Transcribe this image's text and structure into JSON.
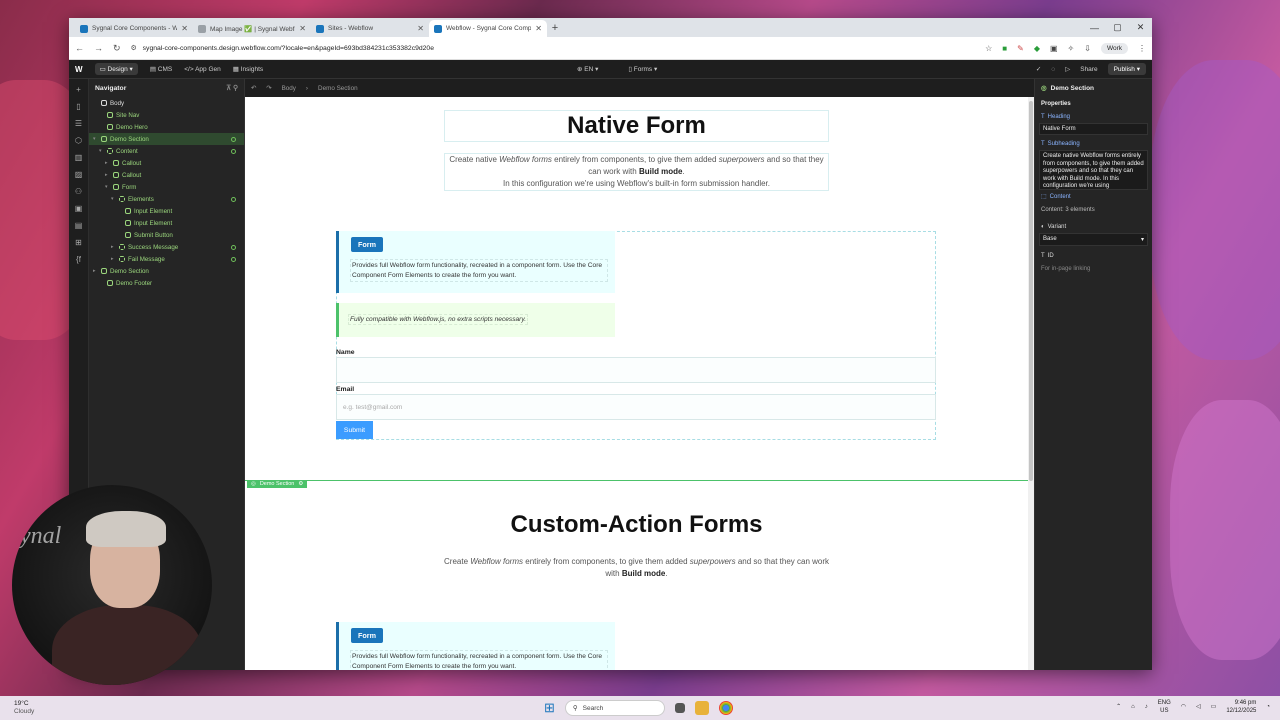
{
  "browser": {
    "tabs": [
      {
        "label": "Sygnal Core Components - We",
        "color": "#1a75bb"
      },
      {
        "label": "Map Image ✅ | Sygnal Webflo",
        "color": "#9aa0a6"
      },
      {
        "label": "Sites - Webflow",
        "color": "#1a75bb"
      },
      {
        "label": "Webflow - Sygnal Core Comp",
        "color": "#1a75bb"
      }
    ],
    "url": "sygnal-core-components.design.webflow.com/?locale=en&pageId=693bd384231c353382c9d20e",
    "profile_label": "Work"
  },
  "webflow_top": {
    "mode_label": "Design",
    "menu": [
      "CMS",
      "App Gen",
      "Insights"
    ],
    "locale": "EN",
    "page_label": "Forms",
    "share_label": "Share",
    "publish_label": "Publish"
  },
  "navigator": {
    "title": "Navigator",
    "items": [
      {
        "label": "Body",
        "indent": 0
      },
      {
        "label": "Site Nav",
        "indent": 1
      },
      {
        "label": "Demo Hero",
        "indent": 1
      },
      {
        "label": "Demo Section",
        "indent": 1
      },
      {
        "label": "Content",
        "indent": 2
      },
      {
        "label": "Callout",
        "indent": 3
      },
      {
        "label": "Callout",
        "indent": 3
      },
      {
        "label": "Form",
        "indent": 3
      },
      {
        "label": "Elements",
        "indent": 4
      },
      {
        "label": "Input Element",
        "indent": 5
      },
      {
        "label": "Input Element",
        "indent": 5
      },
      {
        "label": "Submit Button",
        "indent": 5
      },
      {
        "label": "Success Message",
        "indent": 4
      },
      {
        "label": "Fail Message",
        "indent": 4
      },
      {
        "label": "Demo Section",
        "indent": 1
      },
      {
        "label": "Demo Footer",
        "indent": 1
      }
    ]
  },
  "canvas_bar": {
    "crumb_body": "Body",
    "crumb_section": "Demo Section",
    "width_label": "1566px"
  },
  "page": {
    "native_title": "Native Form",
    "native_sub_1": "Create native",
    "native_sub_em1": "Webflow forms",
    "native_sub_2": "entirely from components, to give them added",
    "native_sub_em2": "superpowers",
    "native_sub_3": "and so that they can work with",
    "native_sub_bold": "Build mode",
    "native_sub_line2": "In this configuration we're using Webflow's built-in form submission handler.",
    "callout_badge": "Form",
    "callout_desc": "Provides full Webflow form functionality, recreated in a component form. Use the Core Component Form Elements to create the form you want.",
    "callout2_text": "Fully compatible with Webflow.js, no extra scripts necessary.",
    "name_label": "Name",
    "email_label": "Email",
    "email_placeholder": "e.g. test@gmail.com",
    "submit_label": "Submit",
    "section_tag": "Demo Section",
    "custom_title": "Custom-Action Forms",
    "custom_sub_1": "Create",
    "custom_sub_em1": "Webflow forms",
    "custom_sub_2": "entirely from components, to give them added",
    "custom_sub_em2": "superpowers",
    "custom_sub_3": "and so that they can work with",
    "custom_sub_bold": "Build mode",
    "callout3_badge": "Form",
    "callout3_desc": "Provides full Webflow form functionality, recreated in a component form. Use the Core Component Form Elements to create the form you want."
  },
  "props": {
    "header": "Demo Section",
    "section_label": "Properties",
    "heading_label": "Heading",
    "heading_value": "Native Form",
    "subheading_label": "Subheading",
    "subheading_value": "Create native Webflow forms entirely from components, to give them added superpowers and so that they can work with Build mode. In this configuration we're using",
    "content_label": "Content",
    "content_value": "Content: 3 elements",
    "variant_label": "Variant",
    "variant_value": "Base",
    "id_label": "ID",
    "id_placeholder": "For in-page linking"
  },
  "taskbar": {
    "temp": "19°C",
    "condition": "Cloudy",
    "search_label": "Search",
    "lang_1": "ENG",
    "lang_2": "US",
    "time": "9:46 pm",
    "date": "12/12/2025"
  },
  "webcam": {
    "watermark": "ynal"
  }
}
